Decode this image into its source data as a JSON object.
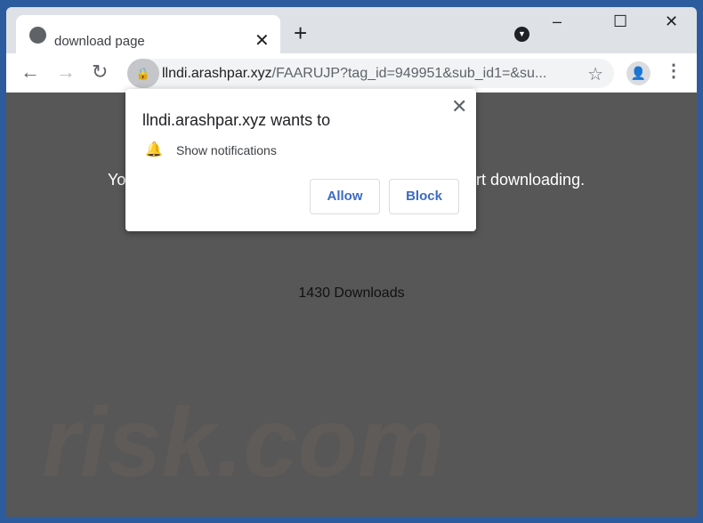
{
  "tab": {
    "title": "download page",
    "close_icon": "close-icon",
    "favicon": "globe-icon"
  },
  "toolbar": {
    "new_tab": "+",
    "url_host": "llndi.arashpar.xyz",
    "url_path": "/FAARUJP?tag_id=949951&sub_id1=&su..."
  },
  "window_controls": {
    "minimize": "–",
    "maximize": "☐",
    "close": "✕"
  },
  "page": {
    "line_left": "Yo",
    "line_right": "rt downloading.",
    "downloads": "1430 Downloads",
    "watermark": "risk.com"
  },
  "popup": {
    "title": "llndi.arashpar.xyz wants to",
    "permission": "Show notifications",
    "allow": "Allow",
    "block": "Block"
  },
  "colors": {
    "frame": "#2c5c9e",
    "content": "#575757",
    "button_text": "#3c6ac4"
  }
}
